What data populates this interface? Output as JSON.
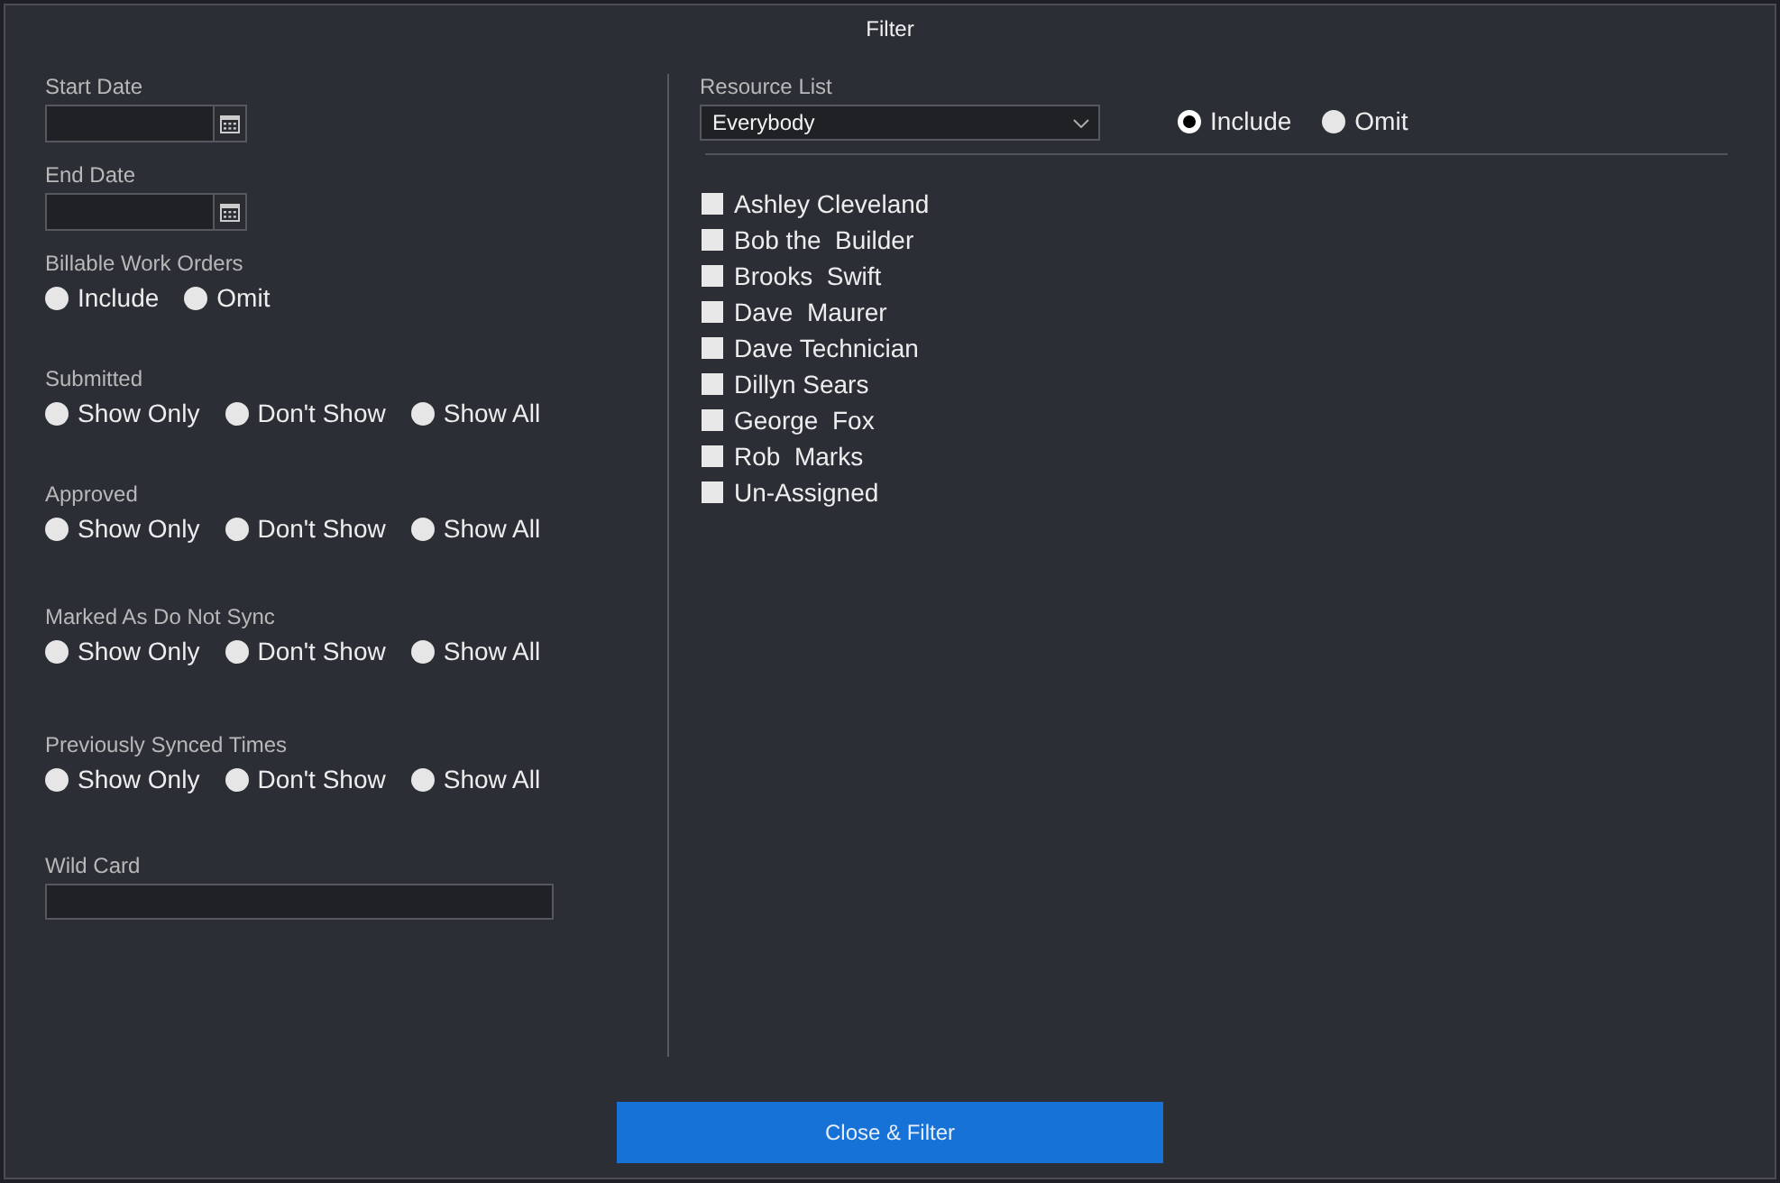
{
  "window": {
    "title": "Filter"
  },
  "filters": [
    {
      "kind": "date",
      "label": "Start Date"
    },
    {
      "kind": "date",
      "label": "End Date"
    },
    {
      "kind": "radio",
      "label": "Billable Work Orders",
      "options": [
        {
          "label": "Include",
          "selected": false
        },
        {
          "label": "Omit",
          "selected": false
        }
      ]
    },
    {
      "kind": "radio",
      "label": "Submitted",
      "options": [
        {
          "label": "Show Only",
          "selected": false
        },
        {
          "label": "Don't Show",
          "selected": false
        },
        {
          "label": "Show All",
          "selected": false
        }
      ]
    },
    {
      "kind": "radio",
      "label": "Approved",
      "options": [
        {
          "label": "Show Only",
          "selected": false
        },
        {
          "label": "Don't Show",
          "selected": false
        },
        {
          "label": "Show All",
          "selected": false
        }
      ]
    },
    {
      "kind": "radio",
      "label": "Marked As Do Not Sync",
      "options": [
        {
          "label": "Show Only",
          "selected": false
        },
        {
          "label": "Don't Show",
          "selected": false
        },
        {
          "label": "Show All",
          "selected": false
        }
      ]
    },
    {
      "kind": "radio",
      "label": "Previously Synced Times",
      "options": [
        {
          "label": "Show Only",
          "selected": false
        },
        {
          "label": "Don't Show",
          "selected": false
        },
        {
          "label": "Show All",
          "selected": false
        }
      ]
    },
    {
      "kind": "text",
      "label": "Wild Card"
    }
  ],
  "resource_list": {
    "label": "Resource List",
    "dropdown": {
      "value": "Everybody"
    },
    "mode_options": [
      {
        "label": "Include",
        "selected": true
      },
      {
        "label": "Omit",
        "selected": false
      }
    ],
    "resources": [
      {
        "name": "Ashley Cleveland",
        "checked": false
      },
      {
        "name": "Bob the  Builder",
        "checked": false
      },
      {
        "name": "Brooks  Swift",
        "checked": false
      },
      {
        "name": "Dave  Maurer",
        "checked": false
      },
      {
        "name": "Dave Technician",
        "checked": false
      },
      {
        "name": "Dillyn Sears",
        "checked": false
      },
      {
        "name": "George  Fox",
        "checked": false
      },
      {
        "name": "Rob  Marks",
        "checked": false
      },
      {
        "name": "Un-Assigned",
        "checked": false
      }
    ]
  },
  "button": {
    "label": "Close & Filter"
  }
}
